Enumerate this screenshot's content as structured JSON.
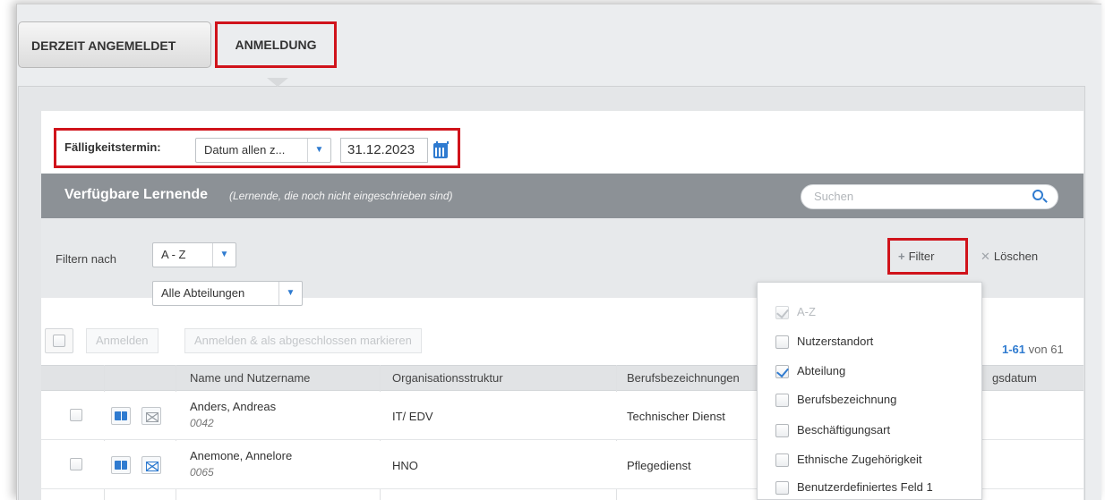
{
  "tabs": [
    {
      "label": "DERZEIT ANGEMELDET",
      "active": false
    },
    {
      "label": "ANMELDUNG",
      "active": true
    }
  ],
  "due_date": {
    "label": "Fälligkeitstermin:",
    "select_value": "Datum allen z...",
    "date_value": "31.12.2023"
  },
  "list": {
    "title": "Verfügbare Lernende",
    "subtitle": "(Lernende, die noch nicht eingeschrieben sind)",
    "search_placeholder": "Suchen"
  },
  "filters": {
    "label": "Filtern nach",
    "sort_value": "A - Z",
    "department_value": "Alle Abteilungen",
    "filter_button": "Filter",
    "clear_button": "Löschen"
  },
  "toolbar": {
    "enroll_label": "Anmelden",
    "enroll_complete_label": "Anmelden & als abgeschlossen markieren",
    "pager_range": "1-61",
    "pager_total": "von 61"
  },
  "table": {
    "columns": [
      "Name und Nutzername",
      "Organisationsstruktur",
      "Berufsbezeichnungen",
      "gsdatum"
    ],
    "rows": [
      {
        "name": "Anders, Andreas",
        "id": "0042",
        "org": "IT/ EDV",
        "job": "Technischer Dienst"
      },
      {
        "name": "Anemone, Annelore",
        "id": "0065",
        "org": "HNO",
        "job": "Pflegedienst"
      }
    ]
  },
  "filter_menu": [
    {
      "label": "A-Z",
      "checked": true,
      "disabled": true
    },
    {
      "label": "Nutzerstandort",
      "checked": false,
      "disabled": false
    },
    {
      "label": "Abteilung",
      "checked": true,
      "disabled": false
    },
    {
      "label": "Berufsbezeichnung",
      "checked": false,
      "disabled": false
    },
    {
      "label": "Beschäftigungsart",
      "checked": false,
      "disabled": false
    },
    {
      "label": "Ethnische Zugehörigkeit",
      "checked": false,
      "disabled": false
    },
    {
      "label": "Benutzerdefiniertes Feld 1",
      "checked": false,
      "disabled": false
    }
  ],
  "colors": {
    "accent": "#2f7bd0",
    "highlight": "#d0131b",
    "header_bar": "#8c9196"
  }
}
